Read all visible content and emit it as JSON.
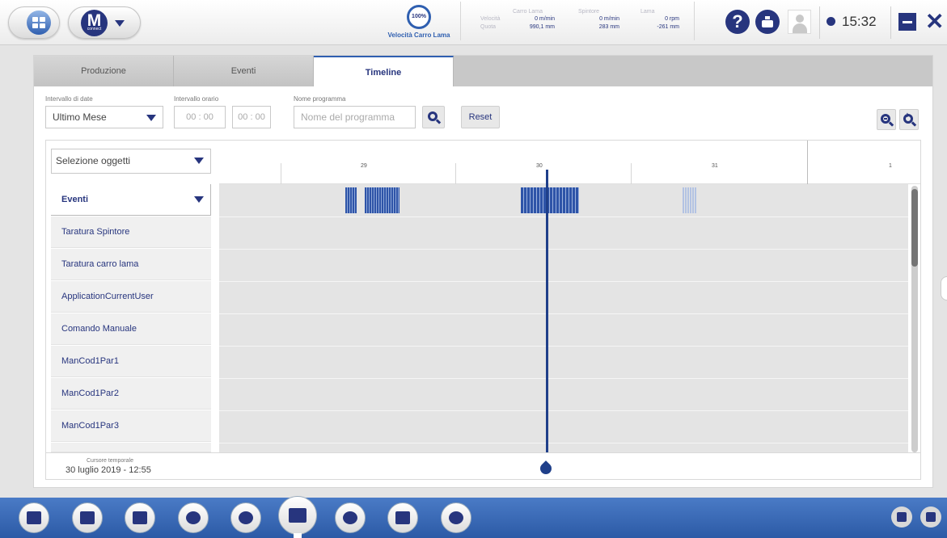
{
  "topbar": {
    "speed_percent": "100%",
    "speed_label": "Velocità Carro Lama",
    "readouts": {
      "headers": [
        "Carro Lama",
        "Spintore",
        "Lama"
      ],
      "velocity_label": "Velocità",
      "position_label": "Quota",
      "velocity": [
        "0 m/min",
        "0 m/min",
        "0 rpm"
      ],
      "position": [
        "990,1 mm",
        "283 mm",
        "-261 mm"
      ]
    },
    "help_glyph": "?",
    "clock": "15:32",
    "close_glyph": "✕"
  },
  "tabs": [
    {
      "label": "Produzione",
      "active": false
    },
    {
      "label": "Eventi",
      "active": false
    },
    {
      "label": "Timeline",
      "active": true
    }
  ],
  "filters": {
    "date_range_label": "Intervallo di date",
    "date_range_value": "Ultimo Mese",
    "time_range_label": "Intervallo orario",
    "time_from": "00 : 00",
    "time_to": "00 : 00",
    "program_label": "Nome programma",
    "program_placeholder": "Nome del programma",
    "reset_label": "Reset"
  },
  "timeline": {
    "object_select": "Selezione oggetti",
    "events_header": "Eventi",
    "rows": [
      "Taratura Spintore",
      "Taratura carro lama",
      "ApplicationCurrentUser",
      "Comando Manuale",
      "ManCod1Par1",
      "ManCod1Par2",
      "ManCod1Par3"
    ],
    "dates": [
      "29",
      "30",
      "31",
      "1"
    ],
    "cursor_label": "Cursore temporale",
    "cursor_value": "30 luglio 2019 - 12:55"
  },
  "dock": {
    "items": [
      "folder-icon",
      "edit-icon",
      "layout-icon",
      "transfer-icon",
      "tools-icon",
      "chart-icon",
      "alert-icon",
      "window-icon",
      "settings-icon"
    ],
    "active": "chart-icon"
  },
  "colors": {
    "accent": "#27357e",
    "bar": "#2e54a8",
    "dock": "#3a69b6"
  }
}
